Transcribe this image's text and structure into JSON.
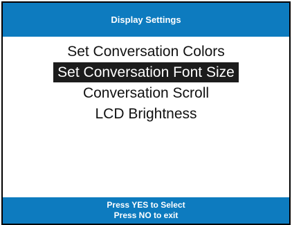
{
  "window": {
    "title": "Display Settings"
  },
  "menu": {
    "items": [
      {
        "label": "Set Conversation Colors",
        "selected": false
      },
      {
        "label": "Set Conversation Font Size",
        "selected": true
      },
      {
        "label": "Conversation Scroll",
        "selected": false
      },
      {
        "label": "LCD Brightness",
        "selected": false
      }
    ]
  },
  "footer": {
    "line1": "Press YES to Select",
    "line2": "Press NO to exit"
  },
  "colors": {
    "accent": "#0d7bbf",
    "selection_bg": "#1c1c1c",
    "text": "#111111",
    "border": "#000000"
  }
}
